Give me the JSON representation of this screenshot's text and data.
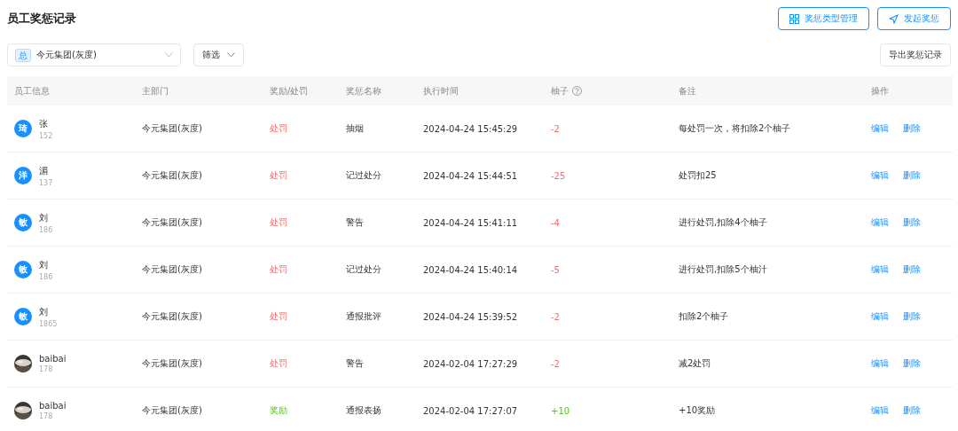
{
  "header_title": "员工奖惩记录",
  "actions": [
    {
      "label": "奖惩类型管理",
      "kind": "grid"
    },
    {
      "label": "发起奖惩",
      "kind": "send"
    }
  ],
  "org_select": {
    "tag": "总",
    "value": "今元集团(灰度)"
  },
  "filter": {
    "label": "筛选"
  },
  "export_button": "导出奖惩记录",
  "columns": [
    "员工信息",
    "主部门",
    "奖励/处罚",
    "奖惩名称",
    "执行时间",
    "柚子",
    "备注",
    "操作"
  ],
  "rows": [
    {
      "avatar": {
        "kind": "letter",
        "text": "琦"
      },
      "name": "张",
      "phone": "152",
      "department": "今元集团(灰度)",
      "type": {
        "kind": "penalty",
        "label": "处罚"
      },
      "reward_name": "抽烟",
      "time": "2024-04-24 15:45:29",
      "points": "-2",
      "note": "每处罚一次，将扣除2个柚子",
      "ops": [
        "编辑",
        "删除"
      ]
    },
    {
      "avatar": {
        "kind": "letter",
        "text": "洋"
      },
      "name": "湄",
      "phone": "137",
      "department": "今元集团(灰度)",
      "type": {
        "kind": "penalty",
        "label": "处罚"
      },
      "reward_name": "记过处分",
      "time": "2024-04-24 15:44:51",
      "points": "-25",
      "note": "处罚扣25",
      "ops": [
        "编辑",
        "删除"
      ]
    },
    {
      "avatar": {
        "kind": "letter",
        "text": "敏"
      },
      "name": "刘",
      "phone": "186",
      "department": "今元集团(灰度)",
      "type": {
        "kind": "penalty",
        "label": "处罚"
      },
      "reward_name": "警告",
      "time": "2024-04-24 15:41:11",
      "points": "-4",
      "note": "进行处罚,扣除4个柚子",
      "ops": [
        "编辑",
        "删除"
      ]
    },
    {
      "avatar": {
        "kind": "letter",
        "text": "敏"
      },
      "name": "刘",
      "phone": "186",
      "department": "今元集团(灰度)",
      "type": {
        "kind": "penalty",
        "label": "处罚"
      },
      "reward_name": "记过处分",
      "time": "2024-04-24 15:40:14",
      "points": "-5",
      "note": "进行处罚,扣除5个柚汁",
      "ops": [
        "编辑",
        "删除"
      ]
    },
    {
      "avatar": {
        "kind": "letter",
        "text": "敏"
      },
      "name": "刘",
      "phone": "1865",
      "department": "今元集团(灰度)",
      "type": {
        "kind": "penalty",
        "label": "处罚"
      },
      "reward_name": "通报批评",
      "time": "2024-04-24 15:39:52",
      "points": "-2",
      "note": "扣除2个柚子",
      "ops": [
        "编辑",
        "删除"
      ]
    },
    {
      "name": "baibai",
      "phone": "178",
      "department": "今元集团(灰度)",
      "type": {
        "kind": "penalty",
        "label": "处罚"
      },
      "reward_name": "警告",
      "time": "2024-02-04 17:27:29",
      "points": "-2",
      "note": "减2处罚",
      "ops": [
        "编辑",
        "删除"
      ]
    },
    {
      "name": "baibai",
      "phone": "178",
      "department": "今元集团(灰度)",
      "type": {
        "kind": "reward",
        "label": "奖励"
      },
      "reward_name": "通报表扬",
      "time": "2024-02-04 17:27:07",
      "points": "+10",
      "note": "+10奖励",
      "ops": [
        "编辑",
        "删除"
      ]
    }
  ]
}
